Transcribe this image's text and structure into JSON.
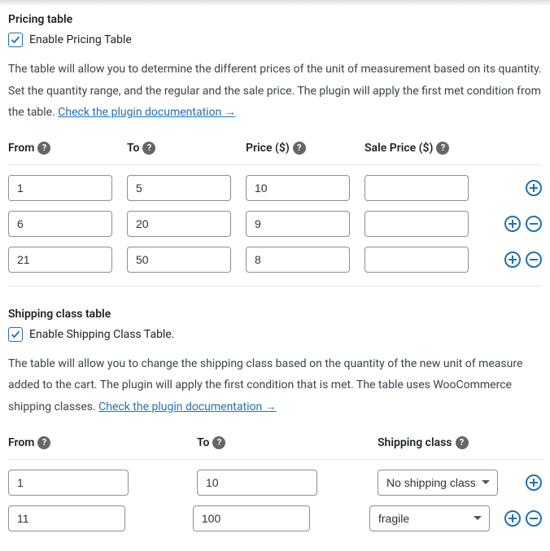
{
  "pricing": {
    "title": "Pricing table",
    "enable_label": "Enable Pricing Table",
    "enabled": true,
    "description_text": "The table will allow you to determine the different prices of the unit of measurement based on its quantity. Set the quantity range, and the regular and the sale price. The plugin will apply the first met condition from the table. ",
    "doc_link_text": "Check the plugin documentation →",
    "headers": {
      "from": "From",
      "to": "To",
      "price": "Price ($)",
      "sale_price": "Sale Price ($)"
    },
    "rows": [
      {
        "from": "1",
        "to": "5",
        "price": "10",
        "sale_price": ""
      },
      {
        "from": "6",
        "to": "20",
        "price": "9",
        "sale_price": ""
      },
      {
        "from": "21",
        "to": "50",
        "price": "8",
        "sale_price": ""
      }
    ]
  },
  "shipping": {
    "title": "Shipping class table",
    "enable_label": "Enable Shipping Class Table.",
    "enabled": true,
    "description_text": "The table will allow you to change the shipping class based on the quantity of the new unit of measure added to the cart. The plugin will apply the first condition that is met. The table uses WooCommerce shipping classes. ",
    "doc_link_text": "Check the plugin documentation →",
    "headers": {
      "from": "From",
      "to": "To",
      "class": "Shipping class"
    },
    "options": [
      "No shipping class",
      "fragile"
    ],
    "rows": [
      {
        "from": "1",
        "to": "10",
        "class": "No shipping class"
      },
      {
        "from": "11",
        "to": "100",
        "class": "fragile"
      }
    ]
  }
}
